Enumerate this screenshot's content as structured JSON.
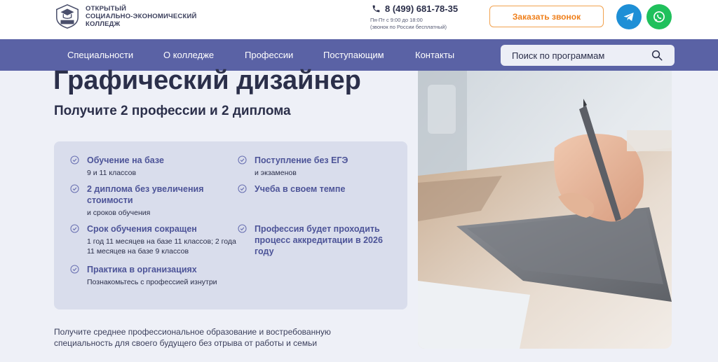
{
  "header": {
    "logo_lines": [
      "ОТКРЫТЫЙ",
      "СОЦИАЛЬНО-ЭКОНОМИЧЕСКИЙ",
      "КОЛЛЕДЖ"
    ],
    "phone": "8 (499) 681-78-35",
    "phone_hours": "Пн-Пт с 9:00 до 18:00",
    "phone_note": "(звонок по России бесплатный)",
    "callback_label": "Заказать звонок",
    "colors": {
      "accent": "#ef7f1a",
      "telegram": "#1e8fd6",
      "whatsapp": "#20c05c"
    }
  },
  "nav": {
    "items": [
      "Специальности",
      "О колледже",
      "Профессии",
      "Поступающим",
      "Контакты"
    ],
    "search_label": "Поиск по программам",
    "color": "#5a62a5"
  },
  "hero": {
    "title": "Графический дизайнер",
    "subtitle": "Получите 2 профессии и 2 диплома",
    "features": [
      {
        "head": "Обучение на базе",
        "desc": "9 и 11 классов"
      },
      {
        "head": "2 диплома без увеличения стоимости",
        "desc": "и сроков обучения"
      },
      {
        "head": "Срок обучения сокращен",
        "desc": "1 год 11 месяцев на базе 11 классов; 2 года 11 месяцев на базе 9 классов"
      },
      {
        "head": "Практика в организациях",
        "desc": "Познакомьтесь с профессией изнутри"
      },
      {
        "head": "Поступление без ЕГЭ",
        "desc": "и экзаменов"
      },
      {
        "head": "Учеба в своем темпе",
        "desc": ""
      },
      {
        "head": "Профессия будет проходить процесс аккредитации в 2026 году",
        "desc": ""
      }
    ],
    "bottom_text": "Получите среднее профессиональное образование и востребованную специальность для своего будущего без отрыва от работы и семьи"
  }
}
